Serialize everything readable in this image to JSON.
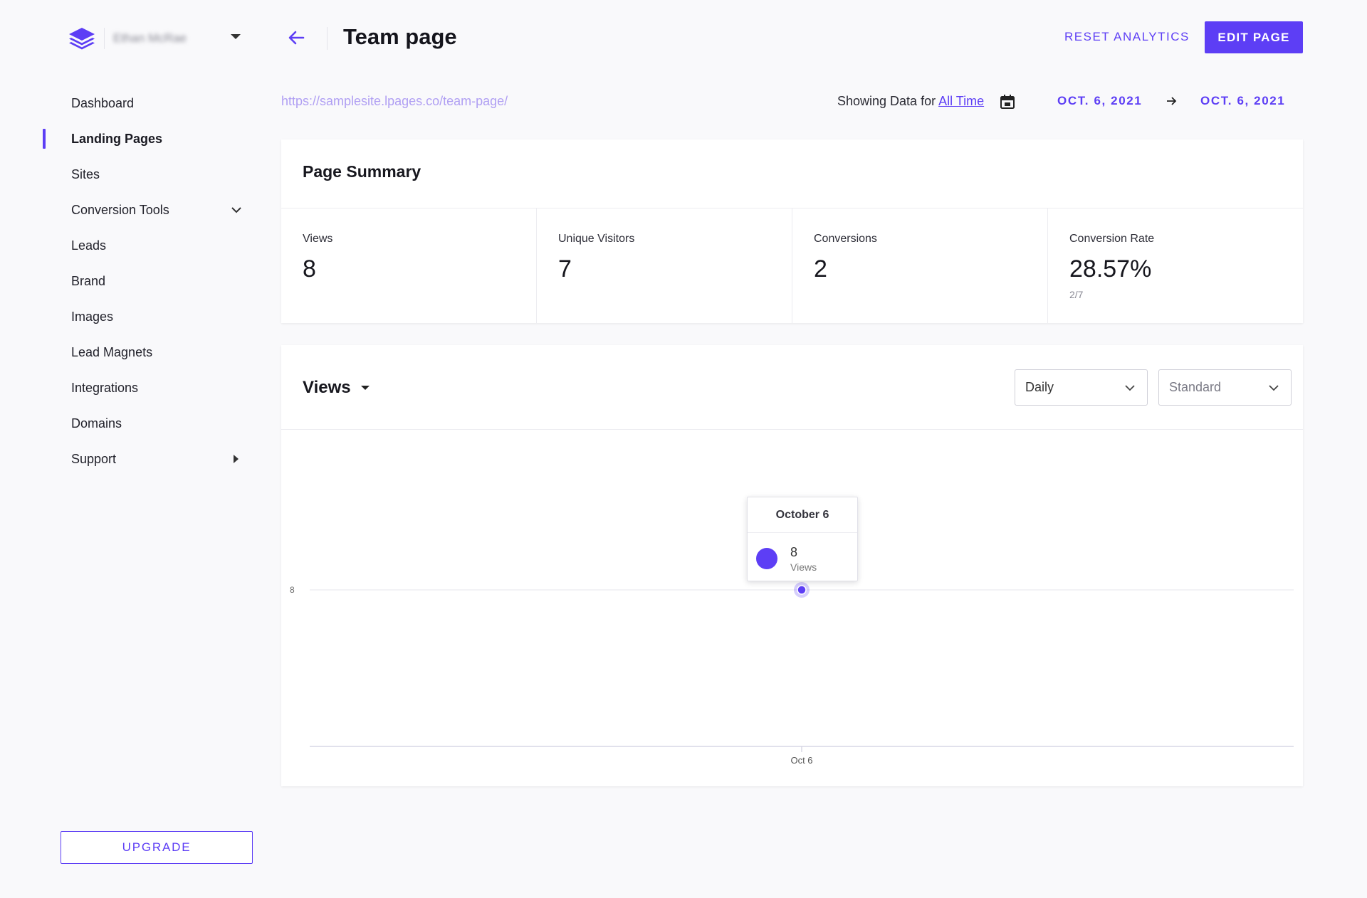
{
  "account": {
    "name": "Ethan McRae"
  },
  "sidebar": {
    "items": [
      {
        "label": "Dashboard"
      },
      {
        "label": "Landing Pages",
        "active": true
      },
      {
        "label": "Sites"
      },
      {
        "label": "Conversion Tools",
        "icon": "chevron-down-icon"
      },
      {
        "label": "Leads"
      },
      {
        "label": "Brand"
      },
      {
        "label": "Images"
      },
      {
        "label": "Lead Magnets"
      },
      {
        "label": "Integrations"
      },
      {
        "label": "Domains"
      },
      {
        "label": "Support",
        "icon": "caret-right-icon"
      }
    ],
    "upgrade_label": "UPGRADE"
  },
  "header": {
    "title": "Team page",
    "reset_label": "RESET ANALYTICS",
    "edit_label": "EDIT PAGE"
  },
  "toolbar": {
    "url": "https://samplesite.lpages.co/team-page/",
    "showing_prefix": "Showing Data for",
    "range_label": "All Time",
    "date_start": "OCT. 6, 2021",
    "date_end": "OCT. 6, 2021"
  },
  "summary": {
    "title": "Page Summary",
    "stats": [
      {
        "label": "Views",
        "value": "8"
      },
      {
        "label": "Unique Visitors",
        "value": "7"
      },
      {
        "label": "Conversions",
        "value": "2"
      },
      {
        "label": "Conversion Rate",
        "value": "28.57%",
        "sub": "2/7"
      }
    ]
  },
  "chart_panel": {
    "metric": "Views",
    "interval": "Daily",
    "mode": "Standard",
    "tooltip": {
      "title": "October 6",
      "value": "8",
      "label": "Views"
    }
  },
  "chart_data": {
    "type": "line",
    "categories": [
      "Oct 6"
    ],
    "series": [
      {
        "name": "Views",
        "values": [
          8
        ]
      }
    ],
    "y_ticks": [
      8
    ],
    "color": "#5d3ef5"
  },
  "colors": {
    "accent": "#5d3ef5",
    "url": "#b09ff3"
  }
}
